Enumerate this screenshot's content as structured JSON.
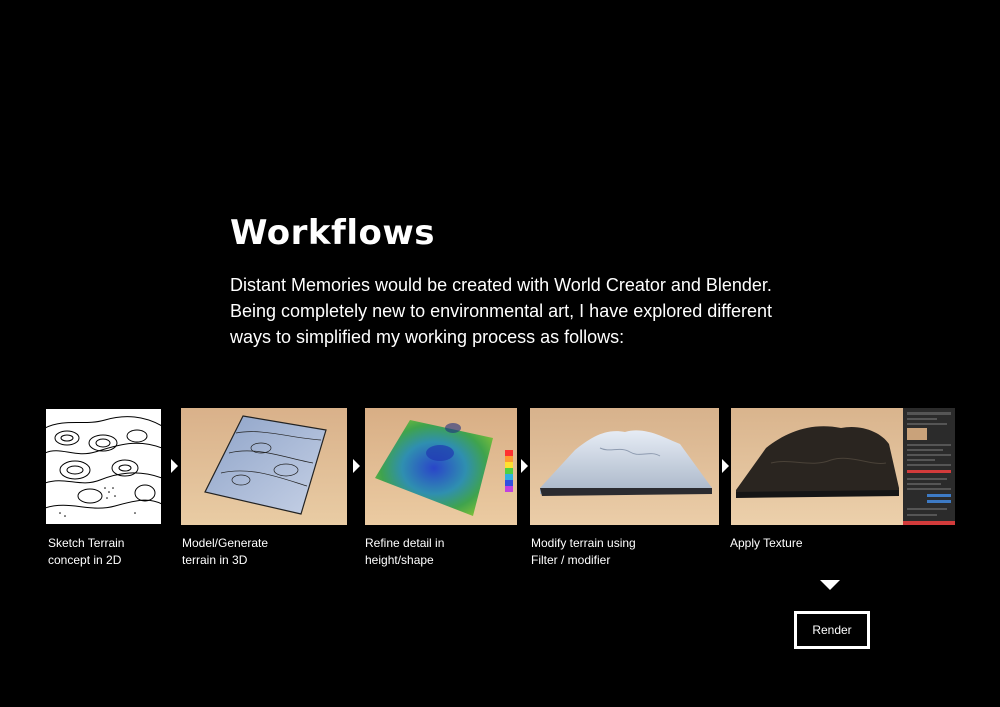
{
  "title": "Workflows",
  "intro": [
    "Distant Memories would be created with World Creator and Blender.",
    "Being completely new to environmental art, I have explored different",
    "ways to simplified my working process as follows:"
  ],
  "steps": [
    {
      "line1": "Sketch Terrain",
      "line2": "concept in 2D",
      "image_icon": "contour-sketch-icon"
    },
    {
      "line1": "Model/Generate",
      "line2": "terrain in 3D",
      "image_icon": "terrain-mesh-icon"
    },
    {
      "line1": "Refine detail in",
      "line2": "height/shape",
      "image_icon": "heightmap-icon"
    },
    {
      "line1": "Modify terrain using",
      "line2": "Filter / modifier",
      "image_icon": "snow-terrain-icon"
    },
    {
      "line1": "Apply Texture",
      "line2": "",
      "image_icon": "textured-terrain-icon"
    }
  ],
  "final_step": "Render",
  "colors": {
    "background": "#000000",
    "text": "#ffffff",
    "sky": "#e8c59a",
    "heightmap_green": "#3fa34d",
    "heightmap_blue": "#2a45c9",
    "snow": "#c9d3e0",
    "dark_terrain": "#2a2520",
    "ui_panel": "#2b2b2b",
    "ui_accent_red": "#d23b3b"
  }
}
